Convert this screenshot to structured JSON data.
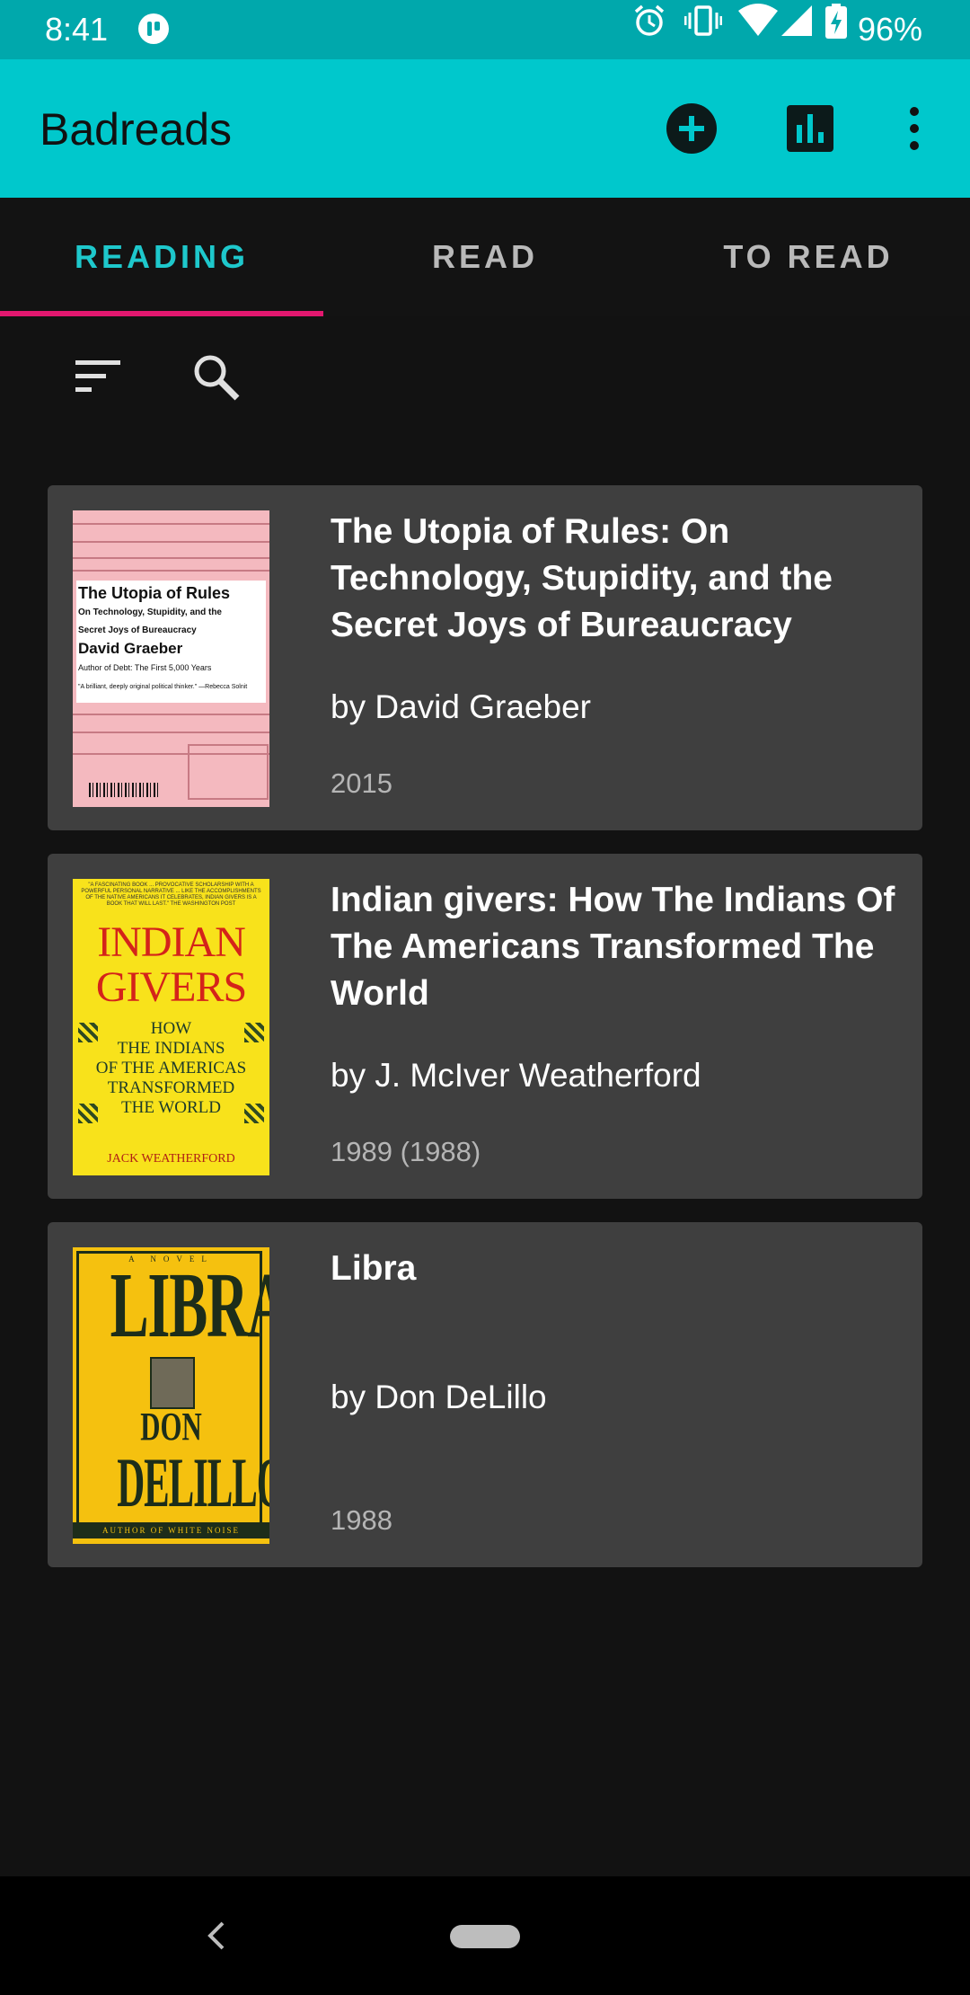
{
  "status_bar": {
    "time": "8:41",
    "battery_percent": "96%",
    "icons": [
      "app-notification-icon",
      "alarm-icon",
      "vibrate-icon",
      "wifi-icon",
      "signal-icon",
      "battery-charging-icon"
    ]
  },
  "toolbar": {
    "title": "Badreads",
    "actions": [
      "add-circle-icon",
      "bar-chart-icon",
      "more-vert-icon"
    ]
  },
  "tabs": [
    {
      "label": "READING",
      "active": true
    },
    {
      "label": "READ",
      "active": false
    },
    {
      "label": "TO READ",
      "active": false
    }
  ],
  "filters": {
    "icons": [
      "sort-icon",
      "search-icon"
    ]
  },
  "books": [
    {
      "title": "The Utopia of Rules: On Technology, Stupidity, and the Secret Joys of Bureaucracy",
      "author": "by David Graeber",
      "year": "2015",
      "cover": {
        "title": "The Utopia of Rules",
        "subtitle1": "On Technology, Stupidity, and the",
        "subtitle2": "Secret Joys of Bureaucracy",
        "author": "David Graeber",
        "note": "Author of Debt: The First 5,000 Years",
        "quote": "\"A brilliant, deeply original political thinker.\" —Rebecca Solnit"
      }
    },
    {
      "title": "Indian givers: How The Indians Of The Americans Transformed The World",
      "author": "by J. McIver Weatherford",
      "year": "1989 (1988)",
      "cover": {
        "blurb": "\"A FASCINATING BOOK ... PROVOCATIVE SCHOLARSHIP WITH A POWERFUL PERSONAL NARRATIVE ... LIKE THE ACCOMPLISHMENTS OF THE NATIVE AMERICANS IT CELEBRATES, INDIAN GIVERS IS A BOOK THAT WILL LAST.\" THE WASHINGTON POST",
        "line1": "INDIAN",
        "line2": "GIVERS",
        "sub1": "HOW",
        "sub2": "THE INDIANS",
        "sub3": "OF THE AMERICAS",
        "sub4": "TRANSFORMED",
        "sub5": "THE WORLD",
        "author": "JACK WEATHERFORD"
      }
    },
    {
      "title": "Libra",
      "author": "by Don DeLillo",
      "year": "1988",
      "cover": {
        "kicker": "A NOVEL",
        "title": "LIBRA",
        "first": "DON",
        "last": "DELILLO",
        "footer": "AUTHOR OF WHITE NOISE"
      }
    }
  ],
  "nav_bar": {
    "icons": [
      "back-icon",
      "home-pill-icon"
    ]
  },
  "colors": {
    "status_bar": "#00a8ac",
    "toolbar": "#00c8cc",
    "background": "#121212",
    "card": "#3f3f3f",
    "tab_active": "#1ec8cc",
    "tab_indicator": "#e2186f"
  }
}
